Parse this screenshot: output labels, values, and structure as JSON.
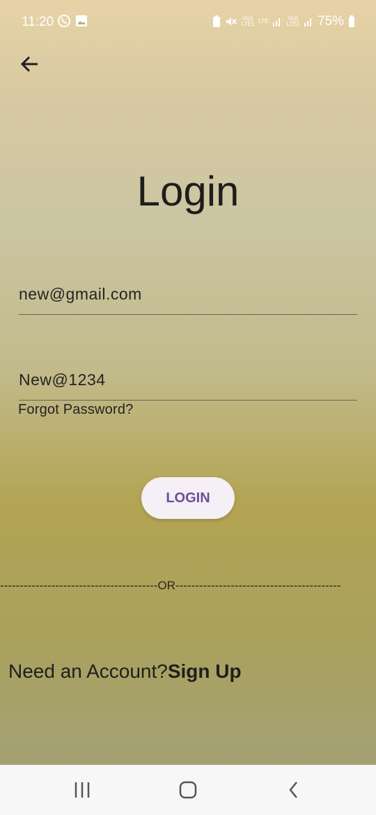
{
  "status_bar": {
    "time": "11:20",
    "battery": "75%",
    "sim1": "Vo))\nLTE1",
    "lte": "LTE",
    "sim2": "Vo))\nLTE2"
  },
  "page": {
    "title": "Login"
  },
  "form": {
    "email_value": "new@gmail.com",
    "password_value": "New@1234",
    "forgot_label": "Forgot Password?",
    "login_label": "LOGIN"
  },
  "divider": {
    "text": "----------------------------------------OR------------------------------------------"
  },
  "signup": {
    "prompt": "Need an Account?",
    "link": "Sign Up"
  },
  "colors": {
    "button_text": "#6a4f98",
    "button_bg": "#f5eff6"
  }
}
